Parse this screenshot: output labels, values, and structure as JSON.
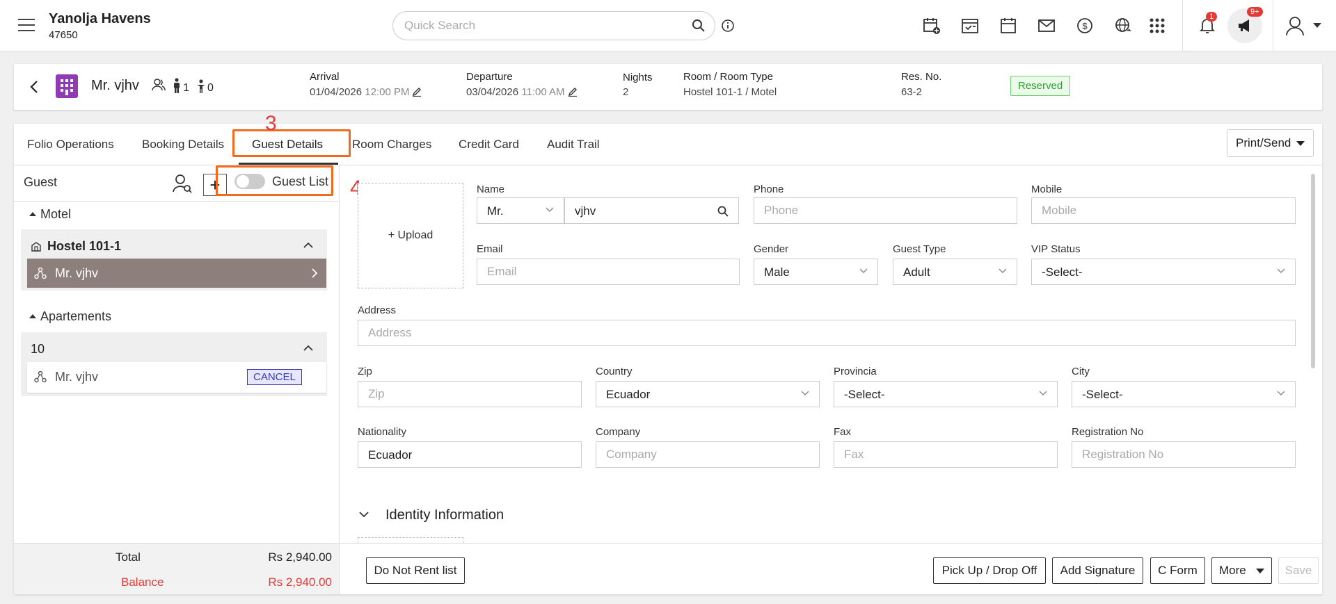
{
  "topbar": {
    "hotel_name": "Yanolja Havens",
    "hotel_id": "47650",
    "search_placeholder": "Quick Search",
    "notification_count": "1",
    "announcement_count": "9+"
  },
  "reservation": {
    "guest_name": "Mr. vjhv",
    "adults": "1",
    "children": "0",
    "arrival_label": "Arrival",
    "arrival_date": "01/04/2026",
    "arrival_time": "12:00 PM",
    "departure_label": "Departure",
    "departure_date": "03/04/2026",
    "departure_time": "11:00 AM",
    "nights_label": "Nights",
    "nights": "2",
    "room_label": "Room / Room Type",
    "room_value": "Hostel 101-1 / Motel",
    "resno_label": "Res. No.",
    "resno_value": "63-2",
    "status": "Reserved",
    "status_color": "#2e9e2e"
  },
  "tabs": [
    {
      "label": "Folio Operations"
    },
    {
      "label": "Booking Details"
    },
    {
      "label": "Guest Details"
    },
    {
      "label": "Room Charges"
    },
    {
      "label": "Credit Card"
    },
    {
      "label": "Audit Trail"
    }
  ],
  "active_tab": "Guest Details",
  "print_send_label": "Print/Send",
  "annotations": {
    "tab_marker": "3",
    "toggle_marker": "4",
    "color": "#f26a1b"
  },
  "left_panel": {
    "guest_label": "Guest",
    "plus_label": "+",
    "toggle_label": "Guest List",
    "groups": [
      {
        "name": "Motel",
        "room": "Hostel 101-1",
        "guests": [
          {
            "name": "Mr. vjhv",
            "selected": true
          }
        ]
      },
      {
        "name": "Apartements",
        "room": "10",
        "guests": [
          {
            "name": "Mr. vjhv",
            "badge": "CANCEL"
          }
        ]
      }
    ],
    "total_label": "Total",
    "total_value": "Rs 2,940.00",
    "balance_label": "Balance",
    "balance_value": "Rs 2,940.00",
    "balance_color": "#e53935"
  },
  "form": {
    "upload_label": "+ Upload",
    "name_label": "Name",
    "title_value": "Mr.",
    "name_value": "vjhv",
    "phone_label": "Phone",
    "phone_placeholder": "Phone",
    "mobile_label": "Mobile",
    "mobile_placeholder": "Mobile",
    "email_label": "Email",
    "email_placeholder": "Email",
    "gender_label": "Gender",
    "gender_value": "Male",
    "guest_type_label": "Guest Type",
    "guest_type_value": "Adult",
    "vip_label": "VIP Status",
    "vip_value": "-Select-",
    "address_label": "Address",
    "address_placeholder": "Address",
    "zip_label": "Zip",
    "zip_placeholder": "Zip",
    "country_label": "Country",
    "country_value": "Ecuador",
    "provincia_label": "Provincia",
    "provincia_value": "-Select-",
    "city_label": "City",
    "city_value": "-Select-",
    "nationality_label": "Nationality",
    "nationality_value": "Ecuador",
    "company_label": "Company",
    "company_placeholder": "Company",
    "fax_label": "Fax",
    "fax_placeholder": "Fax",
    "regno_label": "Registration No",
    "regno_placeholder": "Registration No",
    "identity_section": "Identity Information"
  },
  "footer_buttons": {
    "do_not_rent": "Do Not Rent list",
    "pickup": "Pick Up / Drop Off",
    "signature": "Add Signature",
    "cform": "C Form",
    "more": "More",
    "save": "Save"
  }
}
